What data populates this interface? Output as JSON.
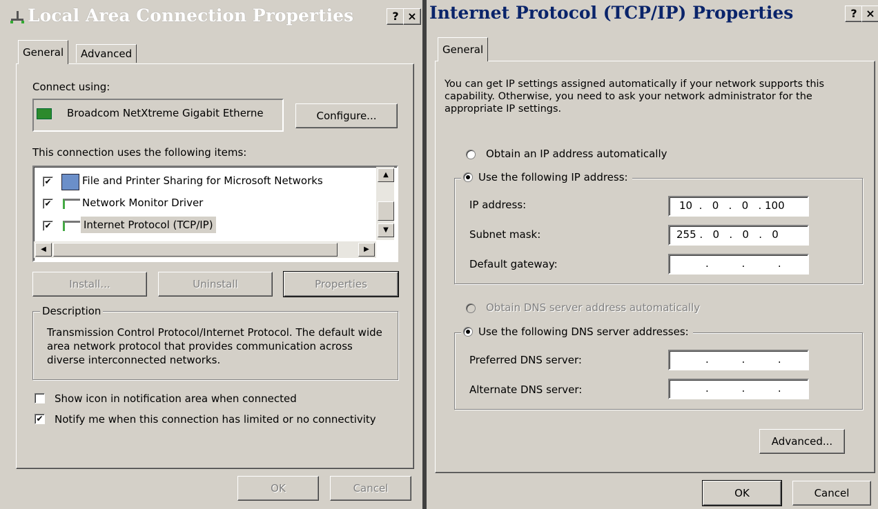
{
  "left": {
    "title": "Local Area Connection Properties",
    "help": "?",
    "close": "×",
    "tabs": [
      "General",
      "Advanced"
    ],
    "connect_using_label": "Connect using:",
    "adapter": "Broadcom NetXtreme Gigabit Etherne",
    "configure_btn": "Configure...",
    "items_label": "This connection uses the following items:",
    "items": [
      {
        "label": "File and Printer Sharing for Microsoft Networks",
        "checked": "✔"
      },
      {
        "label": "Network Monitor Driver",
        "checked": "✔"
      },
      {
        "label": "Internet Protocol (TCP/IP)",
        "checked": "✔"
      }
    ],
    "install_btn": "Install...",
    "uninstall_btn": "Uninstall",
    "properties_btn": "Properties",
    "description_legend": "Description",
    "description_text": "Transmission Control Protocol/Internet Protocol. The default wide area network protocol that provides communication across diverse interconnected networks.",
    "show_icon": {
      "label": "Show icon in notification area when connected",
      "checked": ""
    },
    "notify": {
      "label": "Notify me when this connection has limited or no connectivity",
      "checked": "✔"
    },
    "ok_btn": "OK",
    "cancel_btn": "Cancel"
  },
  "right": {
    "title": "Internet Protocol (TCP/IP) Properties",
    "help": "?",
    "close": "×",
    "tab": "General",
    "intro": "You can get IP settings assigned automatically if your network supports this capability. Otherwise, you need to ask your network administrator for the appropriate IP settings.",
    "obtain_ip": "Obtain an IP address automatically",
    "use_ip": "Use the following IP address:",
    "ip_label": "IP address:",
    "ip_value": "10  .   0   .   0   . 100",
    "subnet_label": "Subnet mask:",
    "subnet_value": "255 .   0   .   0   .   0",
    "gateway_label": "Default gateway:",
    "empty_ip": ".          .          .",
    "obtain_dns": "Obtain DNS server address automatically",
    "use_dns": "Use the following DNS server addresses:",
    "pref_dns_label": "Preferred DNS server:",
    "alt_dns_label": "Alternate DNS server:",
    "advanced_btn": "Advanced...",
    "ok_btn": "OK",
    "cancel_btn": "Cancel"
  }
}
